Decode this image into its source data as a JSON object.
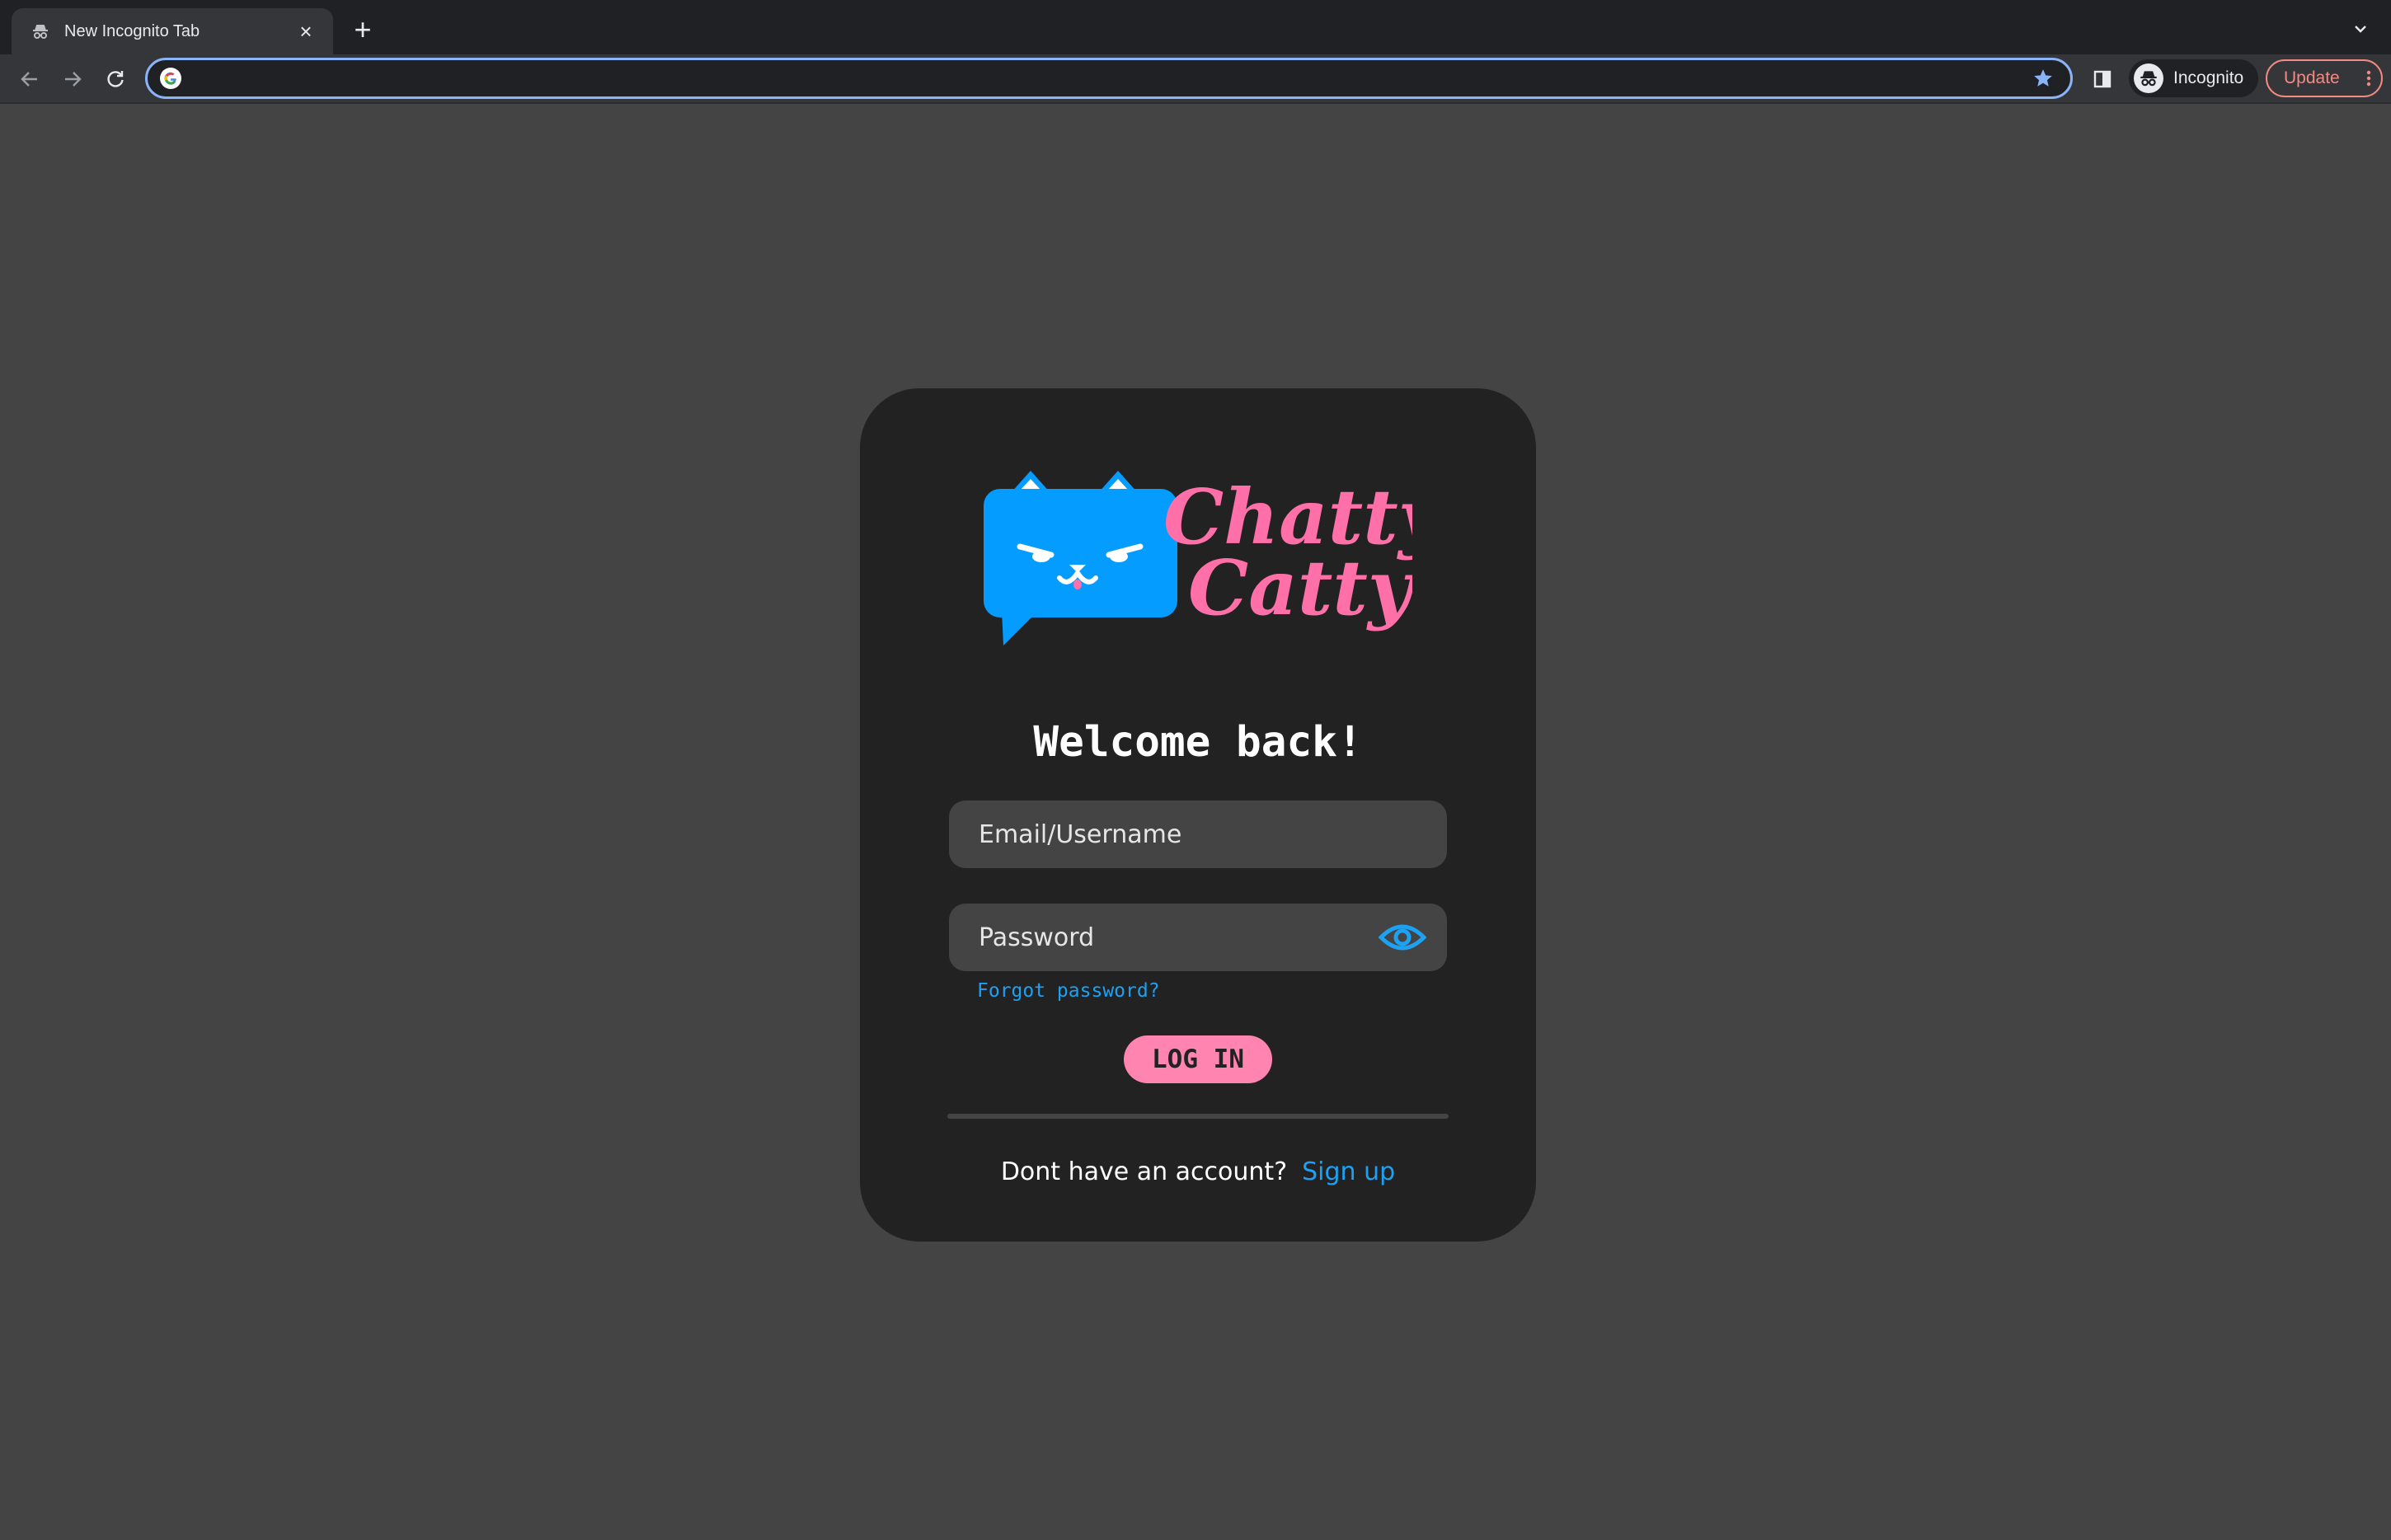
{
  "browser": {
    "tab_title": "New Incognito Tab",
    "tab_close": "×",
    "new_tab": "+",
    "address_value": "",
    "profile_label": "Incognito",
    "update_label": "Update"
  },
  "login": {
    "brand_line1": "Chatty",
    "brand_line2": "Catty",
    "heading": "Welcome back!",
    "email_placeholder": "Email/Username",
    "password_placeholder": "Password",
    "forgot_password": "Forgot password?",
    "login_button": "LOG IN",
    "signup_prompt": "Dont have an account?",
    "signup_link": "Sign up"
  },
  "colors": {
    "brand_blue": "#049DFF",
    "brand_pink": "#FF6FA8",
    "button_pink": "#FF85B0",
    "card_bg": "#222222",
    "page_bg": "#444444"
  },
  "icons": [
    "incognito-icon",
    "close-icon",
    "plus-icon",
    "chevron-down-icon",
    "back-arrow-icon",
    "forward-arrow-icon",
    "reload-icon",
    "google-icon",
    "star-icon",
    "side-panel-icon",
    "kebab-menu-icon",
    "eye-icon",
    "cat-chat-icon"
  ]
}
